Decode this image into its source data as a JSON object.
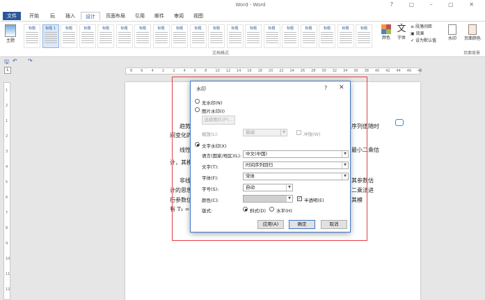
{
  "window": {
    "title": "Word - Word"
  },
  "tabs": [
    "文件",
    "开始",
    "玩",
    "插入",
    "设计",
    "页面布局",
    "引用",
    "邮件",
    "审阅",
    "视图"
  ],
  "active_tab": "设计",
  "ribbon": {
    "theme_label": "主题",
    "style_thumbs": [
      "标题",
      "标题 1",
      "标题",
      "标题",
      "标题",
      "标题",
      "标题",
      "标题",
      "标题",
      "标题",
      "标题",
      "标题",
      "标题",
      "标题",
      "标题",
      "标题",
      "标题",
      "标题",
      "标题"
    ],
    "group_label": "文档格式",
    "colors_label": "颜色",
    "fonts_label": "字体",
    "para_spacing": "段落间距",
    "effects": "效果",
    "set_default": "设为默认值",
    "watermark": "水印",
    "page_color": "页面颜色",
    "page_bg_group": "页面背景"
  },
  "ruler": {
    "ticks": [
      "8",
      "6",
      "4",
      "2",
      "2",
      "4",
      "6",
      "8",
      "10",
      "12",
      "14",
      "16",
      "18",
      "20",
      "22",
      "24",
      "26",
      "28",
      "30",
      "32",
      "34",
      "36",
      "38",
      "40",
      "42",
      "44",
      "46",
      "48"
    ]
  },
  "vruler": {
    "ticks": [
      "1",
      "2",
      "1",
      "2",
      "3",
      "4",
      "5",
      "6",
      "7",
      "8",
      "9",
      "10",
      "11",
      "12"
    ]
  },
  "document": {
    "lines": [
      {
        "text": "趋势",
        "rtext": "序列值随时"
      },
      {
        "text": "间变化的",
        "rtext": ""
      },
      {
        "text": "线性",
        "rtext": "最小二乘估"
      },
      {
        "text": "计，其模",
        "rtext": ""
      },
      {
        "text": "非线",
        "rtext": "其参数估"
      },
      {
        "text": "计的思想",
        "rtext": "二乘法进"
      },
      {
        "text": "行参数估",
        "rtext": "其模"
      },
      {
        "text": "有 T₁ = a",
        "rtext": ""
      }
    ]
  },
  "dialog": {
    "title": "水印",
    "help": "?",
    "close": "✕",
    "no_watermark": "无水印(N)",
    "picture_watermark": "图片水印(I)",
    "select_picture": "选择图片(P)...",
    "scale_label": "缩放(L):",
    "scale_value": "自动",
    "washout": "冲蚀(W)",
    "text_watermark": "文字水印(X)",
    "language_label": "语言(国家/地区)(L):",
    "language_value": "中文(中国)",
    "text_label": "文字(T):",
    "text_value": "时间序列回归",
    "font_label": "字体(F):",
    "font_value": "宋体",
    "size_label": "字号(S):",
    "size_value": "自动",
    "color_label": "颜色(C):",
    "semitransparent": "半透明(E)",
    "layout_label": "版式:",
    "diagonal": "斜式(D)",
    "horizontal": "水平(H)",
    "apply": "应用(A)",
    "ok": "确定",
    "cancel": "取消"
  }
}
